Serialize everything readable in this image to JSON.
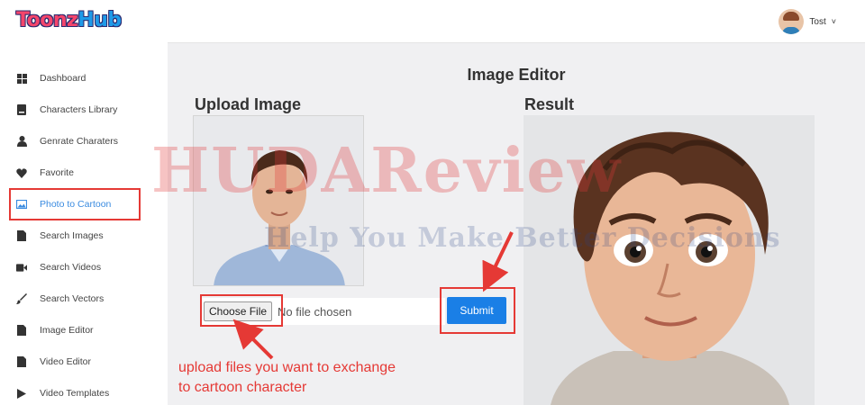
{
  "app": {
    "logo_part1": "Toonz",
    "logo_part2": "Hub"
  },
  "user": {
    "name": "Tost",
    "caret": "˅"
  },
  "sidebar": {
    "items": [
      {
        "label": "Dashboard",
        "icon": "grid-icon"
      },
      {
        "label": "Characters Library",
        "icon": "book-icon"
      },
      {
        "label": "Genrate Charaters",
        "icon": "user-icon"
      },
      {
        "label": "Favorite",
        "icon": "heart-icon"
      },
      {
        "label": "Photo to Cartoon",
        "icon": "image-icon"
      },
      {
        "label": "Search Images",
        "icon": "file-icon"
      },
      {
        "label": "Search Videos",
        "icon": "video-icon"
      },
      {
        "label": "Search Vectors",
        "icon": "brush-icon"
      },
      {
        "label": "Image Editor",
        "icon": "file-icon"
      },
      {
        "label": "Video Editor",
        "icon": "file-icon"
      },
      {
        "label": "Video Templates",
        "icon": "play-icon"
      }
    ],
    "active_color": "#3a8be0"
  },
  "main": {
    "page_title": "Image Editor",
    "upload_title": "Upload Image",
    "result_title": "Result",
    "file_button": "Choose File",
    "file_status": "No file chosen",
    "submit": "Submit"
  },
  "annotation": {
    "line1": "upload files you want to exchange",
    "line2": "to cartoon character"
  },
  "watermark": {
    "main": "HUDAReview",
    "sub": "Help You Make Better Decisions"
  },
  "colors": {
    "accent": "#1a7fe6",
    "annotation": "#e53935"
  }
}
